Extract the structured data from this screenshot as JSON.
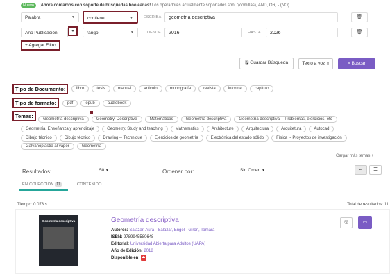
{
  "notice": {
    "badge": "Nuevo",
    "bold": "¡Ahora contamos con soporte de búsquedas booleanas!",
    "rest": "Los operadores actualmente soportados son: \"(comillas), AND, OR, - (NO)"
  },
  "filters": [
    {
      "field": "Palabra",
      "operator": "contiene",
      "label1": "ESCRIBA:",
      "value1": "geometría descriptiva",
      "label2": "",
      "value2": ""
    },
    {
      "field": "Año Publicación",
      "operator": "rango",
      "label1": "DESDE",
      "value1": "2016",
      "label2": "HASTA",
      "value2": "2026"
    }
  ],
  "add_filter": "+ Agregar Filtro",
  "buttons": {
    "save": "Guardar Búsqueda",
    "voice": "Texto a voz",
    "search": "Buscar"
  },
  "doc_type": {
    "title": "Tipo de Documento:",
    "options": [
      "libro",
      "tesis",
      "manual",
      "articulo",
      "monografía",
      "revista",
      "informe",
      "capitulo"
    ]
  },
  "format": {
    "title": "Tipo de formato:",
    "options": [
      "pdf",
      "epub",
      "audiobook"
    ]
  },
  "topics": {
    "title": "Temas:",
    "rows": [
      [
        "Geometría descriptiva",
        "Geometry, Descriptive",
        "Matemáticas",
        "Geometría descriptiva",
        "Geometría descriptiva -- Problemas, ejercicios, etc"
      ],
      [
        "Geometría, Enseñanza y aprendizaje",
        "Geometry, Study and teaching",
        "Mathematics",
        "Architecture",
        "Arquitectura",
        "Arquitetura",
        "Autocad"
      ],
      [
        "Dibujo técnico",
        "Dibujo técnico",
        "Drawing -- Technique",
        "Ejercicios de geometría",
        "Electrónica del estado sólido",
        "Física -- Proyectos de investigación"
      ],
      [
        "Galvanoplastia al vapor",
        "Geometría"
      ]
    ],
    "more": "Cargar más temas +"
  },
  "results_bar": {
    "label": "Resultados:",
    "per_page": "50",
    "order_label": "Ordenar por:",
    "order_value": "Sin Orden"
  },
  "tabs": {
    "collection": "EN COLECCIÓN",
    "collection_count": "11",
    "content": "CONTENIDO"
  },
  "time": "Tiempo: 0.073 s",
  "total": "Total de resultados: 11",
  "result": {
    "title": "Geometría descriptiva",
    "cover_title": "Geometría descriptiva",
    "authors_label": "Autores:",
    "authors": "Salazar, Aura - Salazar, Engel - Girón, Tamara",
    "isbn_label": "ISBN:",
    "isbn": "9789945580648",
    "publisher_label": "Editorial:",
    "publisher": "Universidad Abierta para Adultos (UAPA)",
    "year_label": "Año de Edición:",
    "year": "2018",
    "available_label": "Disponible en:"
  },
  "colors": {
    "accent": "#7a5cc4",
    "highlight_border": "#7a1f2b",
    "new_badge": "#5cb85c",
    "pdf": "#e03a3a"
  }
}
